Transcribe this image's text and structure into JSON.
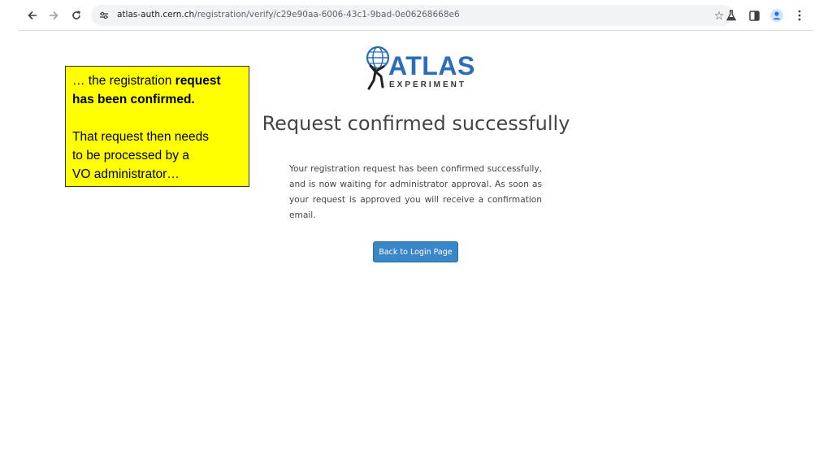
{
  "browser": {
    "url_host": "atlas-auth.cern.ch",
    "url_path": "/registration/verify/c29e90aa-6006-43c1-9bad-0e06268668e6",
    "icons": {
      "back": "arrow-left-icon",
      "forward": "arrow-right-icon",
      "reload": "reload-icon",
      "site_info": "site-settings-icon",
      "bookmark": "star-icon",
      "labs": "flask-icon",
      "side_panel": "side-panel-icon",
      "profile": "profile-icon",
      "menu": "kebab-menu-icon"
    }
  },
  "callout": {
    "line1_normal": "… the registration ",
    "line1_bold": "request",
    "line2_bold": "has been confirmed.",
    "line3": "That request then needs",
    "line4": "to be processed by a",
    "line5": "VO administrator…",
    "background": "#ffff00"
  },
  "logo": {
    "title": "ATLAS",
    "subtitle": "EXPERIMENT",
    "color": "#2a6ebb"
  },
  "page": {
    "heading": "Request confirmed successfully",
    "message": "Your registration request has been confirmed successfully, and is now waiting for administrator approval. As soon as your request is approved you will receive a confirmation email.",
    "button_label": "Back to Login Page",
    "button_color": "#3a87c8"
  }
}
